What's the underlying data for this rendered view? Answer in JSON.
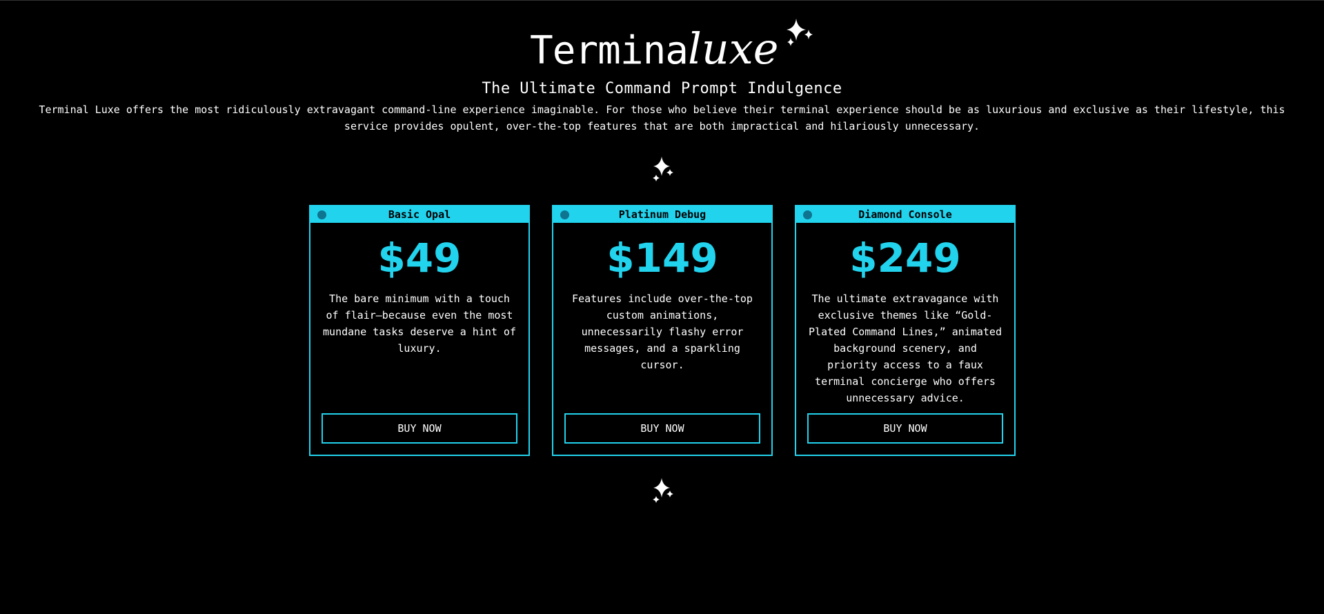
{
  "brand": {
    "logo_main": "Termina",
    "logo_script": "luxe"
  },
  "hero": {
    "subtitle": "The Ultimate Command Prompt Indulgence",
    "description": "Terminal Luxe offers the most ridiculously extravagant command-line experience imaginable. For those who believe their terminal experience should be as luxurious and exclusive as their lifestyle, this service provides opulent, over-the-top features that are both impractical and hilariously unnecessary."
  },
  "plans": [
    {
      "name": "Basic Opal",
      "price": "$49",
      "description": "The bare minimum with a touch of flair—because even the most mundane tasks deserve a hint of luxury.",
      "button": "BUY NOW"
    },
    {
      "name": "Platinum Debug",
      "price": "$149",
      "description": "Features include over-the-top custom animations, unnecessarily flashy error messages, and a sparkling cursor.",
      "button": "BUY NOW"
    },
    {
      "name": "Diamond Console",
      "price": "$249",
      "description": "The ultimate extravagance with exclusive themes like “Gold-Plated Command Lines,” animated background scenery, and priority access to a faux terminal concierge who offers unnecessary advice.",
      "button": "BUY NOW"
    }
  ],
  "icons": {
    "sparkle": "sparkles-icon",
    "window_dot": "window-dot-icon"
  },
  "colors": {
    "accent": "#22d3ee",
    "dot": "#0e7490",
    "background": "#000000",
    "text": "#ffffff"
  }
}
